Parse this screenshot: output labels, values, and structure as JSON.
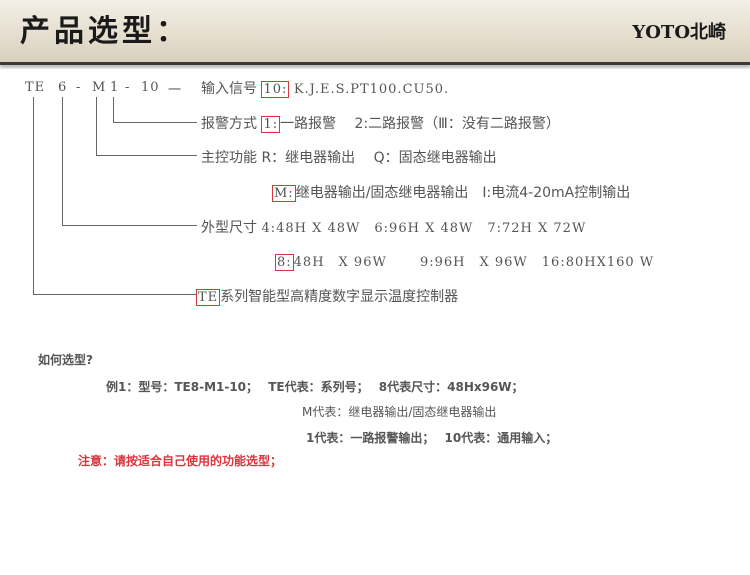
{
  "header": {
    "title": "产品选型：",
    "brand": "YOTO北崎"
  },
  "model_code": {
    "te": "TE",
    "size": "6",
    "d1": "-",
    "func": "M",
    "alarm": "1",
    "d2": "-",
    "input": "10",
    "d3": "一"
  },
  "rows": {
    "input": {
      "label": "输入信号",
      "boxed": "10:",
      "rest": "K.J.E.S.PT100.CU50."
    },
    "alarm": {
      "label": "报警方式",
      "boxed": "1:",
      "rest": "一路报警　 2:二路报警（Ⅲ：没有二路报警）"
    },
    "control": {
      "label": "主控功能",
      "rest": "R：继电器输出　 Q：固态继电器输出"
    },
    "control2": {
      "boxed": "M:",
      "rest": "继电器输出/固态继电器输出　I:电流4-20mA控制输出"
    },
    "size": {
      "label": "外型尺寸",
      "rest": "4:48H X 48W　6:96H X 48W　7:72H X 72W"
    },
    "size2": {
      "boxed": "8:",
      "rest": "48H　X 96W　　 9:96H　X 96W　16:80HX160 W"
    },
    "series": {
      "boxed": "TE",
      "rest": "系列智能型高精度数字显示温度控制器"
    }
  },
  "howto": {
    "title": "如何选型?",
    "line1": "例1：型号：TE8-M1-10；　 TE代表：系列号；　 8代表尺寸：48Hx96W；",
    "line2": "M代表：继电器输出/固态继电器输出",
    "line3": "1代表：一路报警输出；　 10代表：通用输入；",
    "note": "注意：请按适合自己使用的功能选型；"
  }
}
